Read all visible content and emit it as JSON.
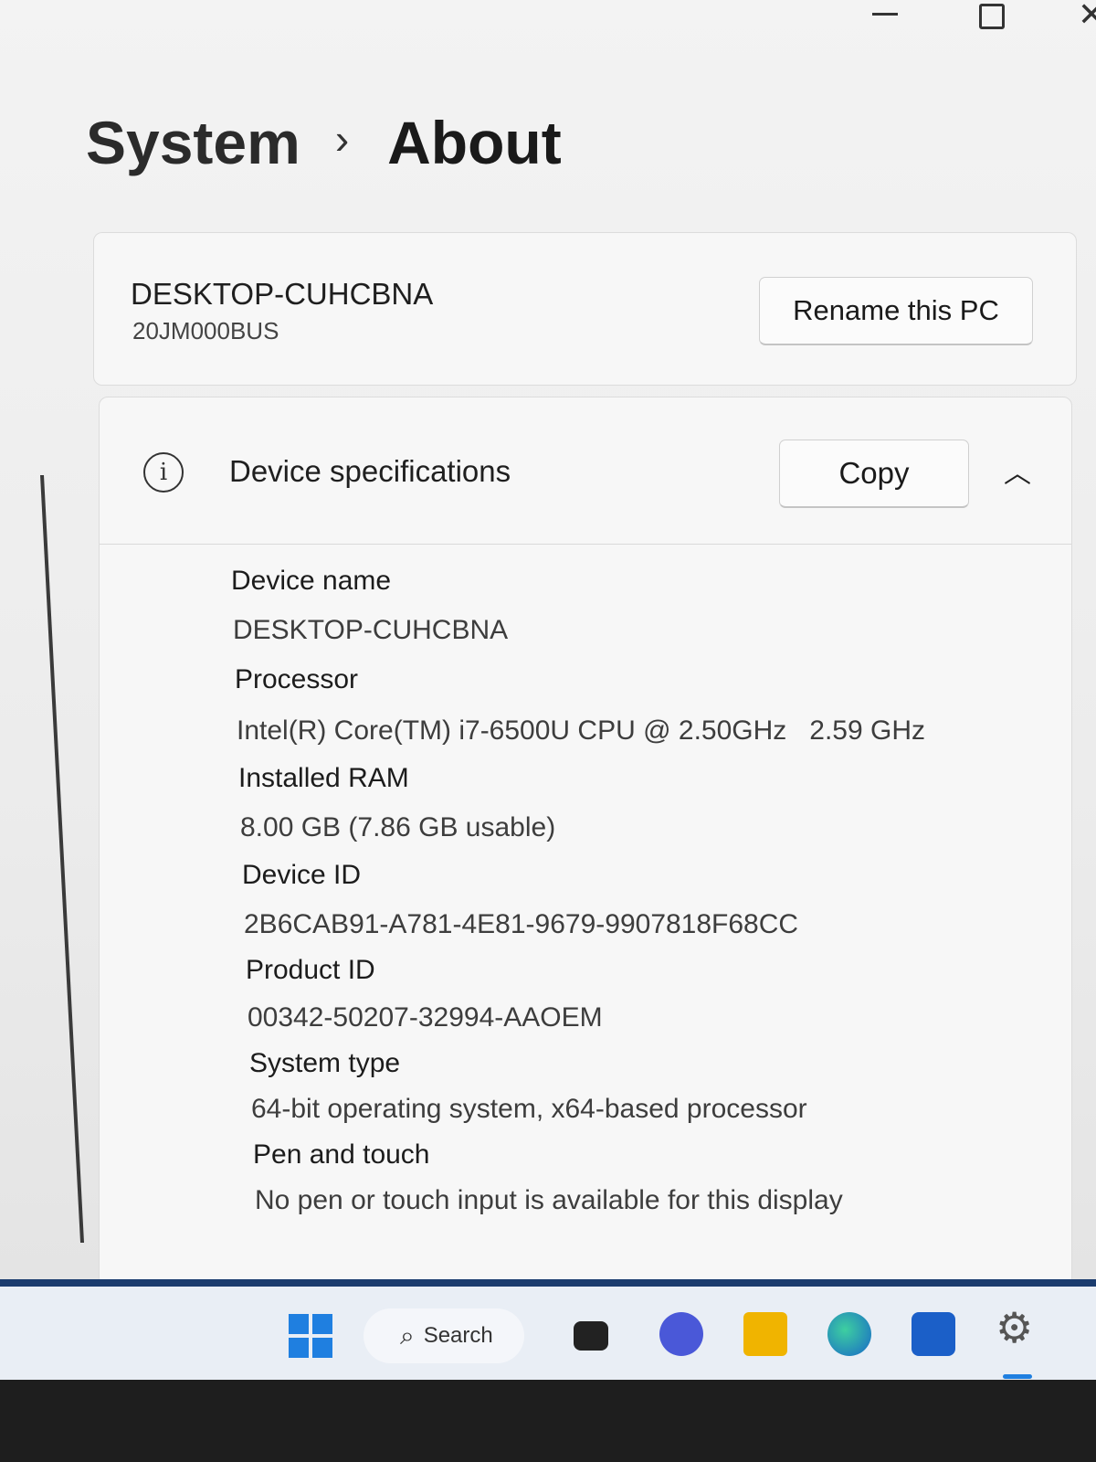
{
  "window": {
    "controls": {
      "minimize": "minimize-icon",
      "maximize": "maximize-icon",
      "close": "close-icon"
    }
  },
  "breadcrumb": {
    "parent": "System",
    "separator": "›",
    "current": "About"
  },
  "pc_card": {
    "name": "DESKTOP-CUHCBNA",
    "model": "20JM000BUS",
    "rename_label": "Rename this PC"
  },
  "device_specs": {
    "icon": "info-icon",
    "title": "Device specifications",
    "copy_label": "Copy",
    "items": [
      {
        "label": "Device name",
        "value": "DESKTOP-CUHCBNA"
      },
      {
        "label": "Processor",
        "value": "Intel(R) Core(TM) i7-6500U CPU @ 2.50GHz   2.59 GHz"
      },
      {
        "label": "Installed RAM",
        "value": "8.00 GB (7.86 GB usable)"
      },
      {
        "label": "Device ID",
        "value": "2B6CAB91-A781-4E81-9679-9907818F68CC"
      },
      {
        "label": "Product ID",
        "value": "00342-50207-32994-AAOEM"
      },
      {
        "label": "System type",
        "value": "64-bit operating system, x64-based processor"
      },
      {
        "label": "Pen and touch",
        "value": "No pen or touch input is available for this display"
      }
    ]
  },
  "taskbar": {
    "search_label": "Search",
    "icons": [
      "windows-start-icon",
      "search-icon",
      "task-view-icon",
      "chat-icon",
      "file-explorer-icon",
      "edge-icon",
      "store-icon",
      "settings-icon"
    ]
  },
  "colors": {
    "accent": "#1f7fe0",
    "taskbar_border": "#1b3c6e"
  }
}
